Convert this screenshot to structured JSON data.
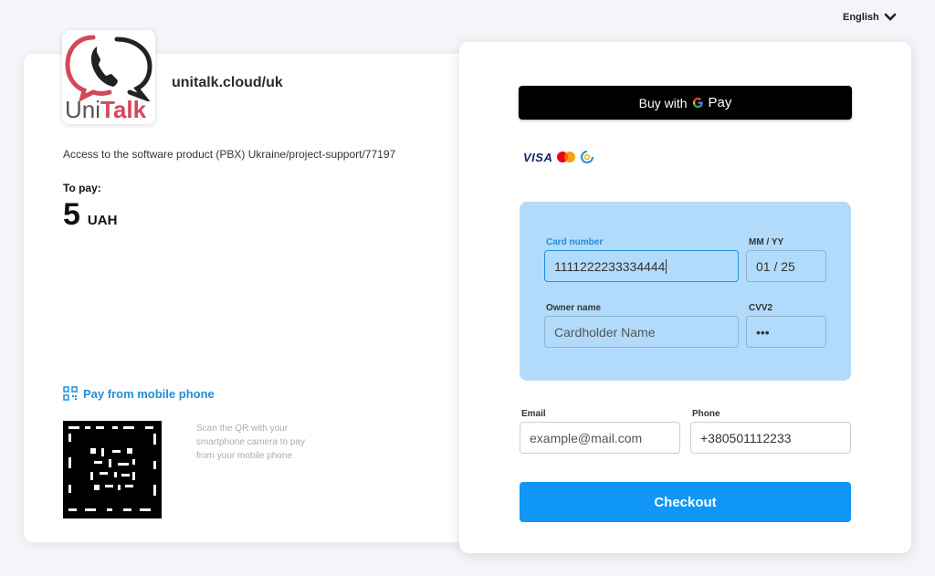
{
  "header": {
    "language": "English",
    "language_icon": "chevron-down-icon"
  },
  "merchant": {
    "logo_text_part1": "Uni",
    "logo_text_part2": "Talk",
    "site": "unitalk.cloud/uk",
    "description": "Access to the software product (PBX) Ukraine/project-support/77197"
  },
  "payment": {
    "to_pay_label": "To pay:",
    "amount": "5",
    "currency": "UAH"
  },
  "mobile": {
    "link_label": "Pay from mobile phone",
    "qr_hint": "Scan the QR with your smartphone camera to pay from your mobile phone"
  },
  "gpay": {
    "label": "Buy with",
    "brand": "Pay"
  },
  "brands": {
    "visa": "VISA"
  },
  "card_form": {
    "card_number_label": "Card number",
    "card_number_value": "1111222233334444",
    "expiry_label": "MM / YY",
    "expiry_value": "01 / 25",
    "owner_label": "Owner name",
    "owner_placeholder": "Cardholder Name",
    "cvv_label": "CVV2",
    "cvv_value": "•••"
  },
  "contact": {
    "email_label": "Email",
    "email_placeholder": "example@mail.com",
    "phone_label": "Phone",
    "phone_value": "+380501112233"
  },
  "checkout_label": "Checkout",
  "colors": {
    "accent": "#0f96f6",
    "link": "#1f8fd8",
    "card_panel": "#b2dbfb",
    "brand_red": "#d4475b"
  }
}
